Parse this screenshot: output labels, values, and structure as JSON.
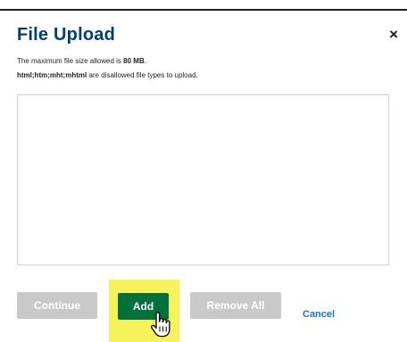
{
  "dialog": {
    "title": "File Upload",
    "close_symbol": "×",
    "info_size_prefix": "The maximum file size allowed is ",
    "info_size_value": "80 MB",
    "info_size_suffix": ".",
    "info_types_value": "html;htm;mht;mhtml",
    "info_types_suffix": " are disallowed file types to upload."
  },
  "buttons": {
    "continue_label": "Continue",
    "add_label": "Add",
    "remove_all_label": "Remove All",
    "cancel_label": "Cancel"
  },
  "colors": {
    "title": "#003f72",
    "add_button": "#00703c",
    "disabled_button": "#c9c9c9",
    "highlight": "#f6f25a",
    "cancel_link": "#1a73c7"
  },
  "icons": {
    "close": "close-icon",
    "cursor": "hand-pointer-icon"
  }
}
